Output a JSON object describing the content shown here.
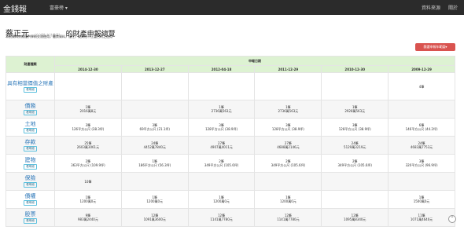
{
  "nav": {
    "brand": "金錢報",
    "menu": "富豪榜 ▾",
    "link1": "資料來源",
    "link2": "關於"
  },
  "header": {
    "person": "蔡正元",
    "subtitle": "(立法院 立法委員)",
    "title": "的財產申報總覽",
    "disclaimer": "本頁資料亦無僅供學術交流使用，嚴禁資料，僅住，或其他不正當目的之使用"
  },
  "range_button": "篩選申報年範圍▾",
  "table": {
    "category_header": "財產種類",
    "date_header": "申報日期",
    "dates": [
      "2014-12-30",
      "2013-12-27",
      "2012-04-18",
      "2011-12-29",
      "2010-12-30",
      "2009-12-29"
    ],
    "detail_label": "看明細",
    "rows": [
      {
        "name": "具有相當價值之財產",
        "cells": [
          [],
          [],
          [],
          [],
          [],
          [
            "4筆"
          ]
        ]
      },
      {
        "name": "債務",
        "cells": [
          [
            "1筆",
            "2016萬8元"
          ],
          [],
          [
            "1筆",
            "2736萬563元"
          ],
          [
            "1筆",
            "2736萬563元"
          ],
          [
            "1筆",
            "2928萬563元"
          ],
          []
        ]
      },
      {
        "name": "土地",
        "cells": [
          [
            "3筆",
            "126平方公尺 (38.3坪)"
          ],
          [
            "3筆",
            "69平方公尺 (21.1坪)"
          ],
          [
            "3筆",
            "128平方公尺 (38.9坪)"
          ],
          [
            "3筆",
            "128平方公尺 (38.9坪)"
          ],
          [
            "3筆",
            "128平方公尺 (38.9坪)"
          ],
          [
            "6筆",
            "146平方公尺 (44.2坪)"
          ]
        ]
      },
      {
        "name": "存款",
        "cells": [
          [
            "25筆",
            "2603萬3061元"
          ],
          [
            "24筆",
            "4452萬7840元"
          ],
          [
            "27筆",
            "4907萬4011元"
          ],
          [
            "27筆",
            "4688萬2146元"
          ],
          [
            "24筆",
            "5129萬3219元"
          ],
          [
            "24筆",
            "4683萬7753元"
          ]
        ]
      },
      {
        "name": "建物",
        "cells": [
          [
            "2筆",
            "363平方公尺 (109.9坪)"
          ],
          [
            "1筆",
            "186平方公尺 (56.3坪)"
          ],
          [
            "2筆",
            "349平方公尺 (105.6坪)"
          ],
          [
            "2筆",
            "349平方公尺 (105.6坪)"
          ],
          [
            "2筆",
            "349平方公尺 (105.6坪)"
          ],
          [
            "3筆",
            "320平方公尺 (96.9坪)"
          ]
        ]
      },
      {
        "name": "保險",
        "cells": [
          [
            "10筆"
          ],
          [],
          [],
          [],
          [],
          []
        ]
      },
      {
        "name": "債權",
        "cells": [
          [
            "1筆",
            "1200萬0元"
          ],
          [
            "1筆",
            "1200萬0元"
          ],
          [
            "1筆",
            "1200萬0元"
          ],
          [
            "1筆",
            "1200萬0元"
          ],
          [],
          [
            "1筆",
            "1500萬0元"
          ]
        ]
      },
      {
        "name": "股票",
        "cells": [
          [
            "9筆",
            "983萬2440元"
          ],
          [
            "12筆",
            "1091萬3600元"
          ],
          [
            "12筆",
            "1141萬7780元"
          ],
          [
            "12筆",
            "1141萬7780元"
          ],
          [
            "12筆",
            "1095萬8340元"
          ],
          [
            "11筆",
            "1071萬4640元"
          ]
        ]
      }
    ]
  }
}
